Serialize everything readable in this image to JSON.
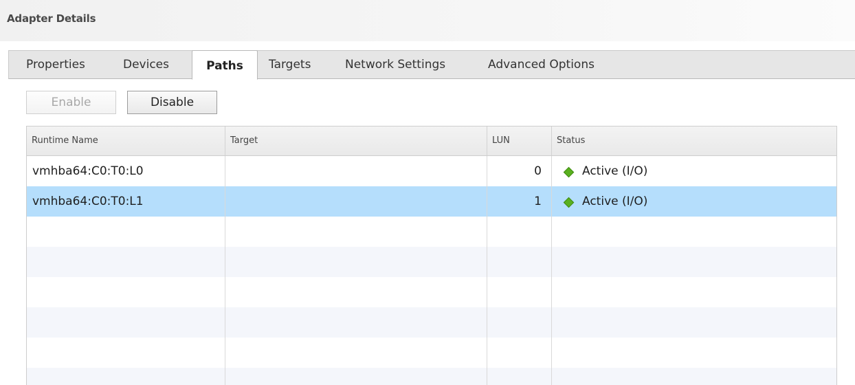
{
  "header": {
    "title": "Adapter Details"
  },
  "tabs": [
    {
      "label": "Properties",
      "active": false
    },
    {
      "label": "Devices",
      "active": false
    },
    {
      "label": "Paths",
      "active": true
    },
    {
      "label": "Targets",
      "active": false
    },
    {
      "label": "Network Settings",
      "active": false
    },
    {
      "label": "Advanced Options",
      "active": false
    }
  ],
  "toolbar": {
    "enable_label": "Enable",
    "enable_disabled": true,
    "disable_label": "Disable"
  },
  "table": {
    "columns": [
      "Runtime Name",
      "Target",
      "LUN",
      "Status"
    ],
    "rows": [
      {
        "runtime_name": "vmhba64:C0:T0:L0",
        "target": "",
        "lun": "0",
        "status": "Active (I/O)",
        "status_icon": "green-diamond-icon",
        "selected": false
      },
      {
        "runtime_name": "vmhba64:C0:T0:L1",
        "target": "",
        "lun": "1",
        "status": "Active (I/O)",
        "status_icon": "green-diamond-icon",
        "selected": true
      }
    ]
  },
  "colors": {
    "selected_row": "#b5defc",
    "status_active": "#5ab01f",
    "alt_row": "#f4f6fb"
  }
}
